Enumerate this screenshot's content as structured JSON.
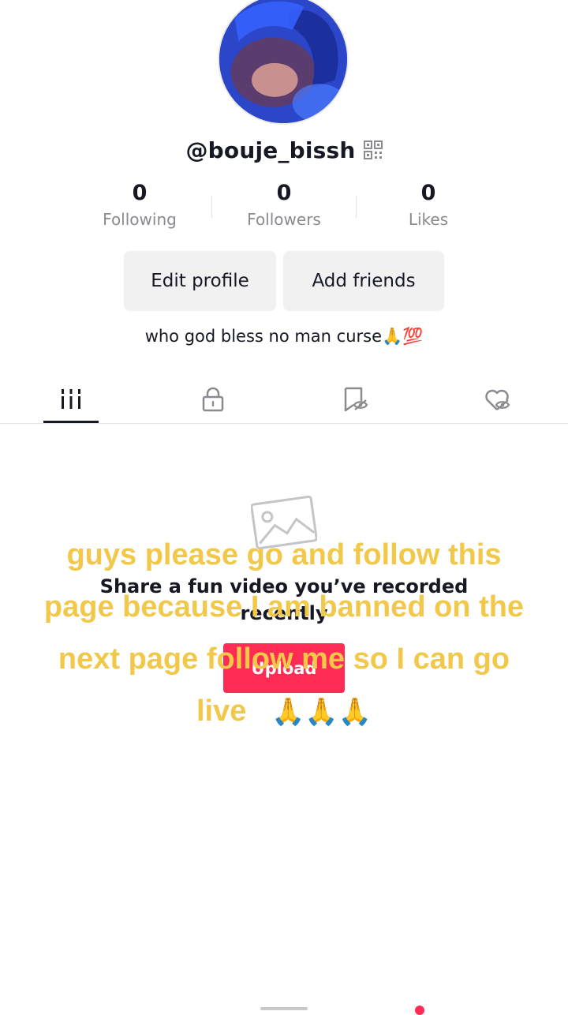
{
  "profile": {
    "username": "@bouje_bissh",
    "bio": "who god bless no man curse🙏💯"
  },
  "stats": [
    {
      "value": "0",
      "label": "Following"
    },
    {
      "value": "0",
      "label": "Followers"
    },
    {
      "value": "0",
      "label": "Likes"
    }
  ],
  "buttons": {
    "edit_profile": "Edit profile",
    "add_friends": "Add friends"
  },
  "tabs": [
    {
      "icon": "videos-grid-icon",
      "active": true
    },
    {
      "icon": "lock-icon",
      "active": false
    },
    {
      "icon": "saved-hidden-icon",
      "active": false
    },
    {
      "icon": "liked-hidden-icon",
      "active": false
    }
  ],
  "empty_state": {
    "icon": "image-placeholder-icon",
    "message": "Share a fun video you’ve recorded recently",
    "upload_label": "Upload"
  },
  "overlay_text": {
    "line1": "guys please go and follow this",
    "line2": "page because I am banned on the",
    "line3": "next page follow me so I can go",
    "line4": "live",
    "emojis": "🙏🙏🙏"
  },
  "colors": {
    "accent": "#fe2c55",
    "overlay_text": "#f2c84b",
    "button_bg": "#f1f1f2",
    "secondary_text": "#8a8b91"
  }
}
